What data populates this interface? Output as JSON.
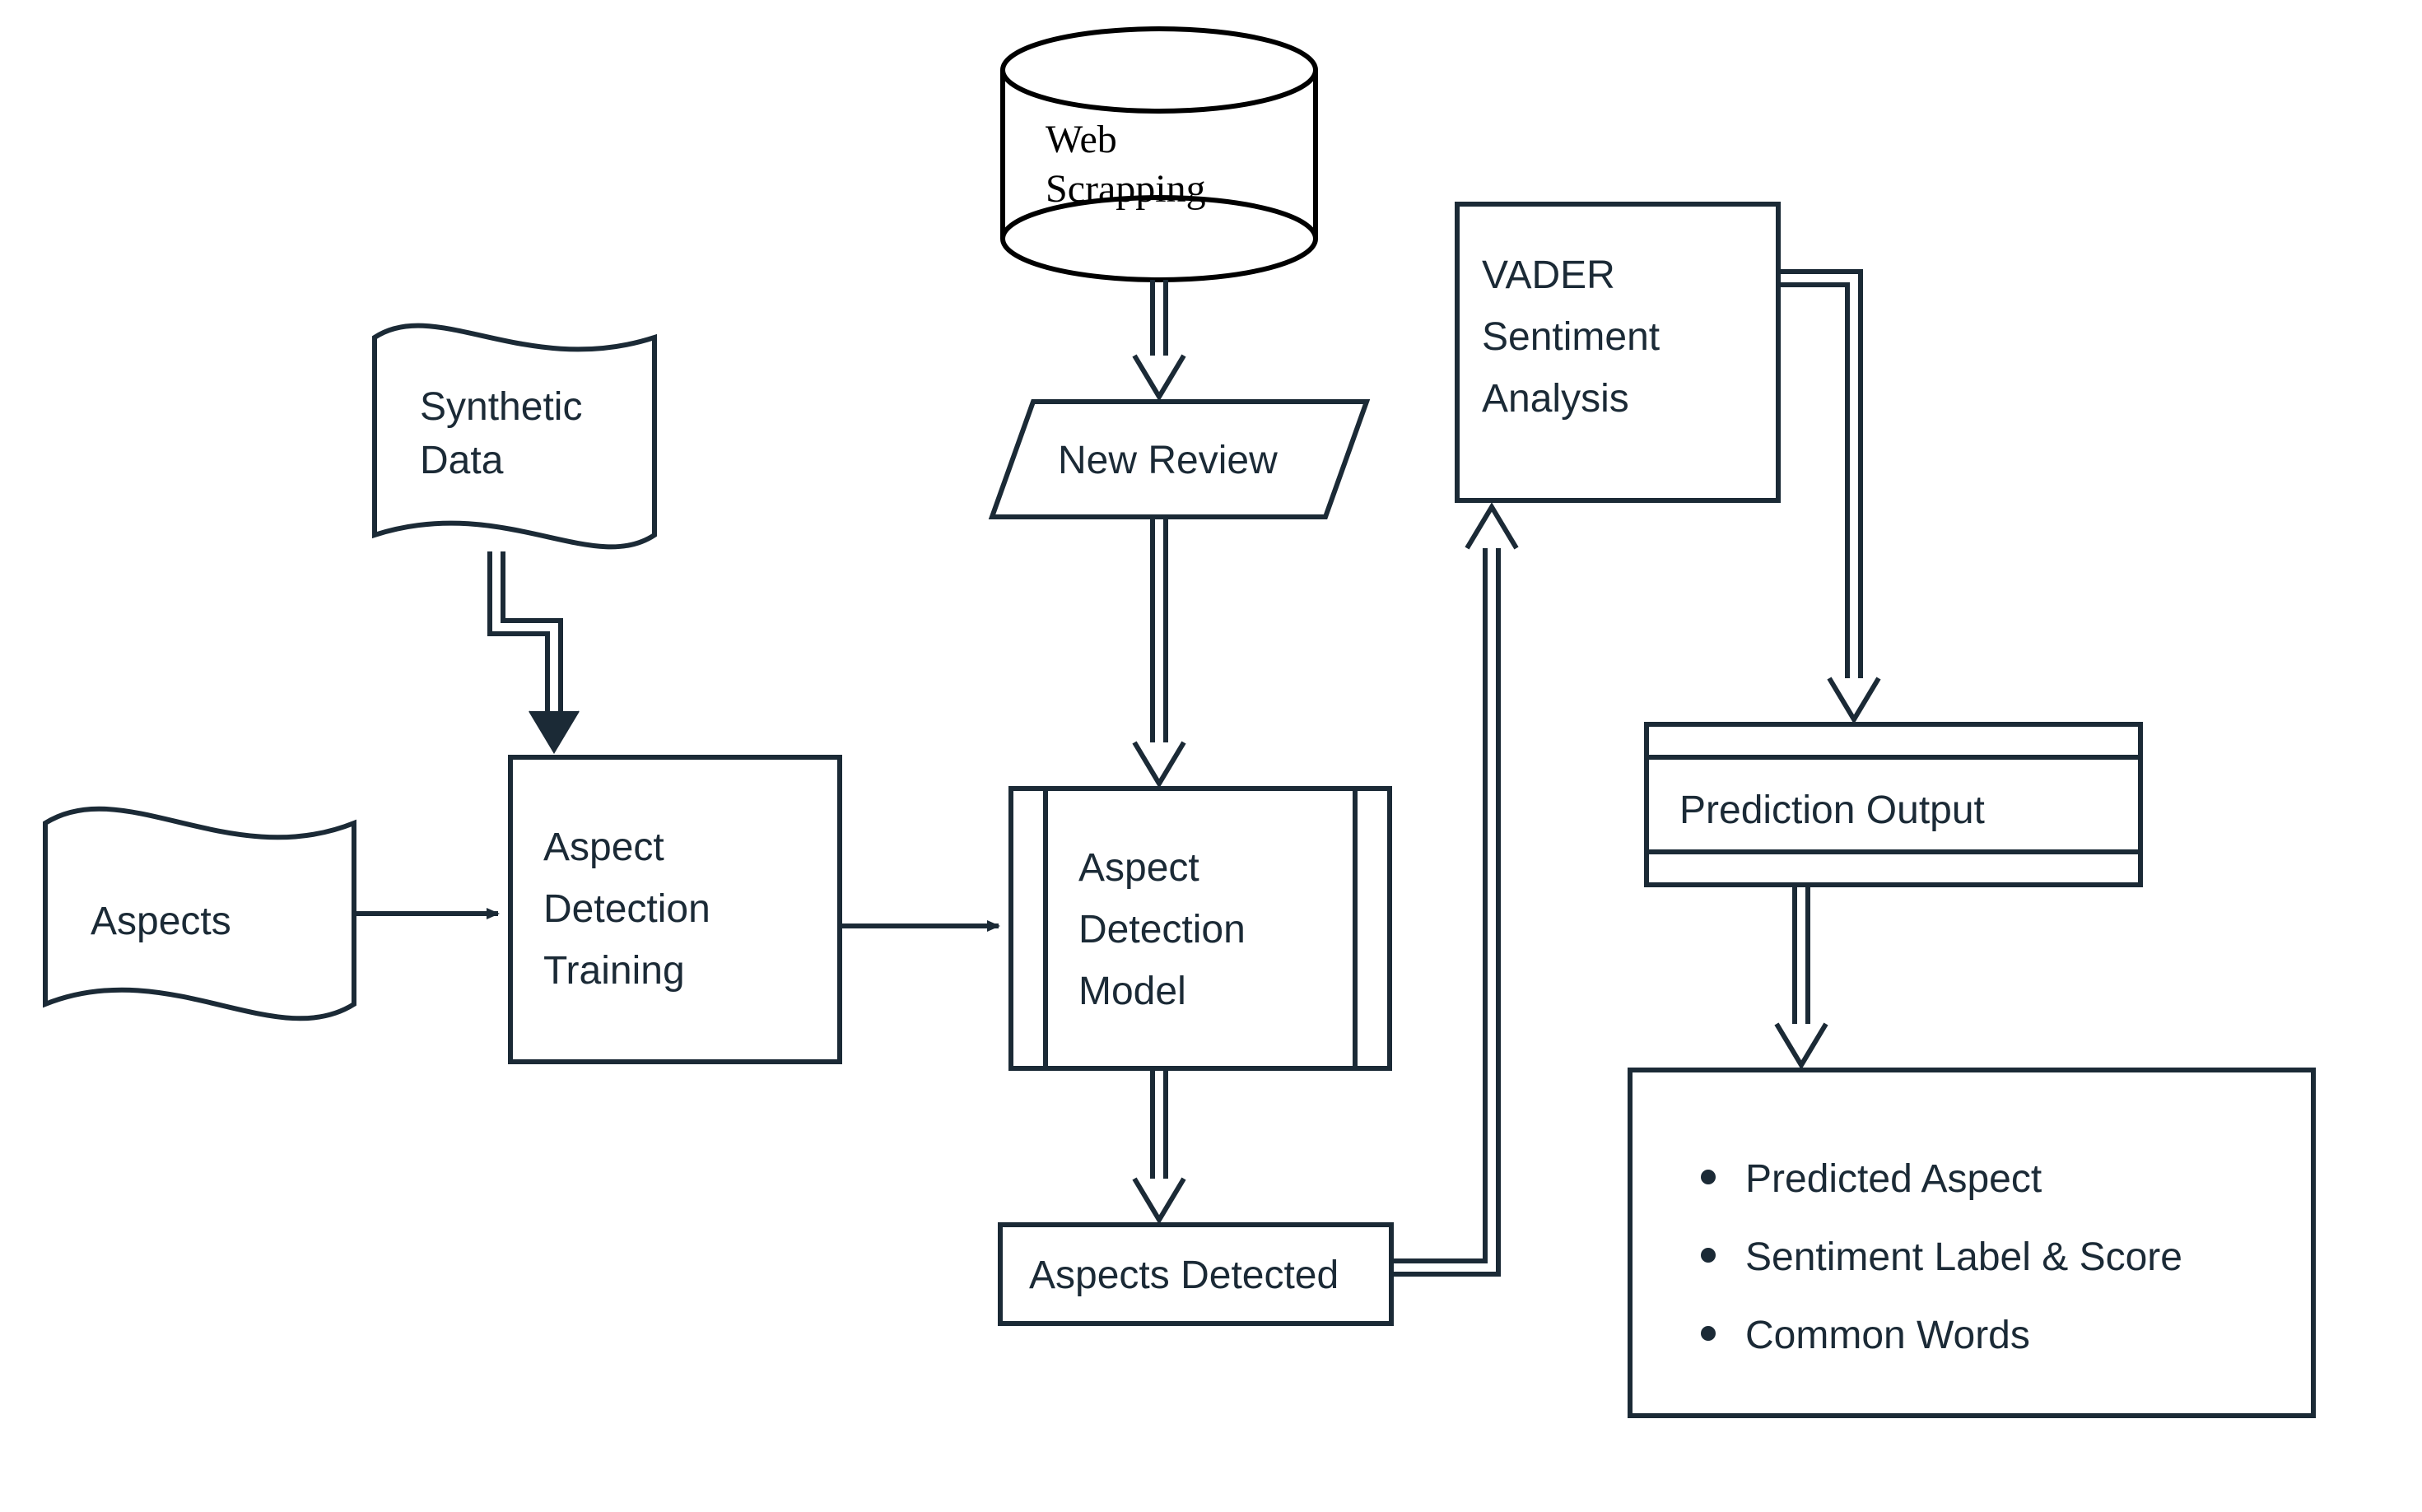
{
  "nodes": {
    "web_scrapping_l1": "Web",
    "web_scrapping_l2": "Scrapping",
    "synthetic_data_l1": "Synthetic",
    "synthetic_data_l2": "Data",
    "aspects": "Aspects",
    "aspect_detection_training_l1": "Aspect",
    "aspect_detection_training_l2": "Detection",
    "aspect_detection_training_l3": "Training",
    "new_review": "New Review",
    "aspect_detection_model_l1": "Aspect",
    "aspect_detection_model_l2": "Detection",
    "aspect_detection_model_l3": "Model",
    "aspects_detected": "Aspects Detected",
    "vader_l1": "VADER",
    "vader_l2": " Sentiment",
    "vader_l3": "Analysis",
    "prediction_output": "Prediction Output",
    "output_bullets": [
      "Predicted Aspect",
      "Sentiment Label & Score",
      "Common Words"
    ]
  },
  "styling": {
    "stroke": "#1b2a36",
    "stroke_width": 6,
    "stroke_width_thin": 4
  }
}
